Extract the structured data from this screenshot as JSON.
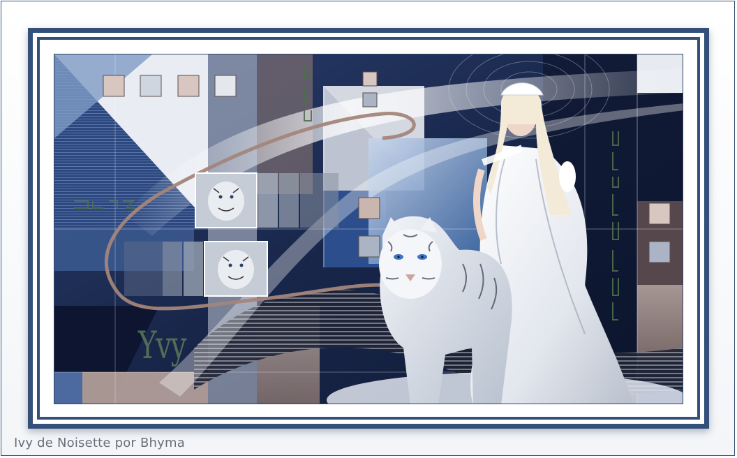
{
  "artwork": {
    "author_mark": "Yvy",
    "credit": "Ivy de Noisette por Bhyma",
    "subjects": [
      "woman-in-white-gown",
      "white-tiger"
    ]
  },
  "colors": {
    "frame": "#34507a",
    "navy": "#1d2e54",
    "steel_blue": "#5b78a6",
    "taupe": "#a99690",
    "silver": "#dfe3ea",
    "signature_green": "#5c7a5a"
  }
}
